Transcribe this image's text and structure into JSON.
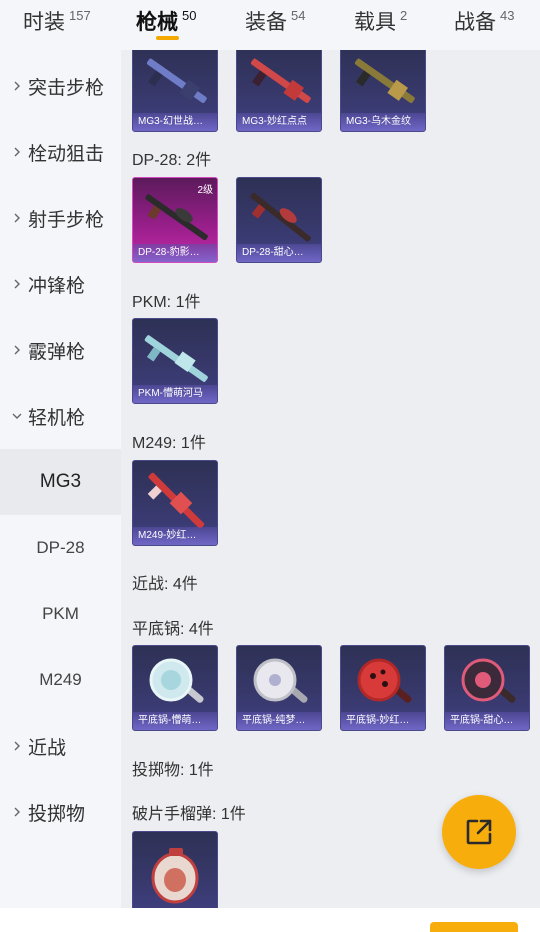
{
  "tabs": [
    {
      "label": "时装",
      "count": "157"
    },
    {
      "label": "枪械",
      "count": "50"
    },
    {
      "label": "装备",
      "count": "54"
    },
    {
      "label": "载具",
      "count": "2"
    },
    {
      "label": "战备",
      "count": "43"
    }
  ],
  "active_tab": "枪械",
  "sidebar": {
    "categories": [
      {
        "label": "突击步枪"
      },
      {
        "label": "栓动狙击"
      },
      {
        "label": "射手步枪"
      },
      {
        "label": "冲锋枪"
      },
      {
        "label": "霰弹枪"
      },
      {
        "label": "轻机枪"
      },
      {
        "label": "近战"
      },
      {
        "label": "投掷物"
      }
    ],
    "sub_items": [
      {
        "label": "MG3"
      },
      {
        "label": "DP-28"
      },
      {
        "label": "PKM"
      },
      {
        "label": "M249"
      }
    ],
    "active_sub": "MG3"
  },
  "content": {
    "row_mg3": [
      {
        "name": "MG3-幻世战…"
      },
      {
        "name": "MG3-妙红点点"
      },
      {
        "name": "MG3-乌木金纹"
      }
    ],
    "dp28_title": "DP-28: 2件",
    "row_dp28": [
      {
        "name": "DP-28-豹影…",
        "level": "2级"
      },
      {
        "name": "DP-28-甜心…"
      }
    ],
    "pkm_title": "PKM: 1件",
    "row_pkm": [
      {
        "name": "PKM-懵萌河马"
      }
    ],
    "m249_title": "M249: 1件",
    "row_m249": [
      {
        "name": "M249-妙红…"
      }
    ],
    "melee_title": "近战: 4件",
    "pan_title": "平底锅: 4件",
    "row_pan": [
      {
        "name": "平底锅-懵萌…"
      },
      {
        "name": "平底锅-纯梦…"
      },
      {
        "name": "平底锅-妙红…"
      },
      {
        "name": "平底锅-甜心…"
      }
    ],
    "throw_title": "投掷物: 1件",
    "grenade_title": "破片手榴弹: 1件"
  },
  "colors": {
    "accent": "#f5a800",
    "card_bg": "#37386a",
    "card_epic": "#9b1f8d"
  },
  "icons": {
    "share": "share-export-icon",
    "chevron": "chevron-right-icon"
  }
}
